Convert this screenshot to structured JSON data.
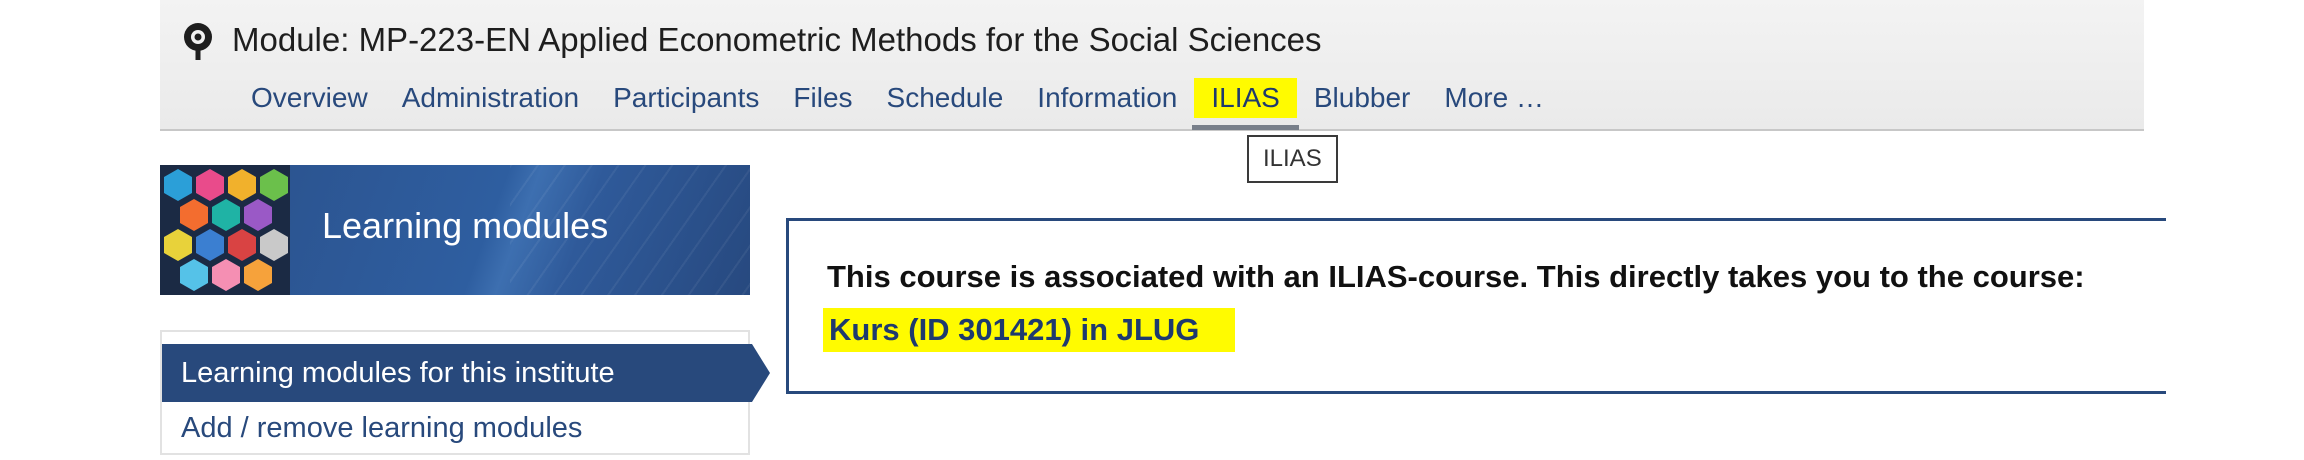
{
  "header": {
    "title": "Module: MP-223-EN Applied Econometric Methods for the Social Sciences",
    "icon": "course-icon"
  },
  "nav": {
    "items": [
      {
        "label": "Overview"
      },
      {
        "label": "Administration"
      },
      {
        "label": "Participants"
      },
      {
        "label": "Files"
      },
      {
        "label": "Schedule"
      },
      {
        "label": "Information"
      },
      {
        "label": "ILIAS",
        "active": true
      },
      {
        "label": "Blubber"
      },
      {
        "label": "More …"
      }
    ],
    "tooltip": "ILIAS"
  },
  "sidebar": {
    "banner_title": "Learning modules",
    "items": [
      {
        "label": "Learning modules for this institute",
        "active": true
      },
      {
        "label": "Add / remove learning modules"
      }
    ]
  },
  "main": {
    "message": "This course is associated with an ILIAS-course. This directly takes you to the course:",
    "link": "Kurs (ID 301421) in JLUG"
  },
  "colors": {
    "brand": "#28497c",
    "highlight": "#fffb00"
  }
}
